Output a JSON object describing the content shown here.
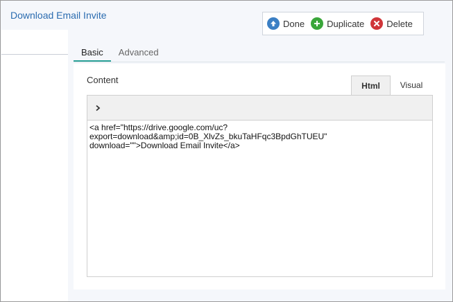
{
  "header": {
    "title": "Download Email Invite"
  },
  "toolbar": {
    "buttons": [
      {
        "label": "Done",
        "icon": "arrow-up-icon",
        "color": "#3b7fc4"
      },
      {
        "label": "Duplicate",
        "icon": "plus-icon",
        "color": "#3aa63a"
      },
      {
        "label": "Delete",
        "icon": "x-icon",
        "color": "#d0363a"
      }
    ]
  },
  "tabs": [
    {
      "label": "Basic",
      "active": true
    },
    {
      "label": "Advanced",
      "active": false
    }
  ],
  "content": {
    "label": "Content",
    "mode_tabs": [
      {
        "label": "Html",
        "active": true
      },
      {
        "label": "Visual",
        "active": false
      }
    ],
    "code_lines": [
      "<a href=\"https://drive.google.com/uc?",
      "export=download&amp;id=0B_XlvZs_bkuTaHFqc3BpdGhTUEU\"",
      "download=\"\">Download Email Invite</a>"
    ]
  },
  "colors": {
    "accent_tab": "#2aa197",
    "title_link": "#2b6cb0"
  }
}
